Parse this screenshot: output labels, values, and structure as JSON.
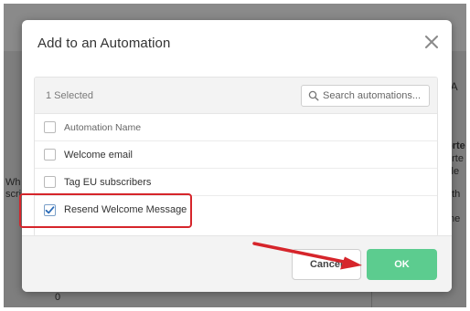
{
  "background": {
    "left_text_1": "Wh",
    "left_text_2": "scri",
    "right_text_1": "nt A",
    "right_text_2": "orte",
    "right_text_3": "orte",
    "right_text_4": "file",
    "right_text_5": "nth",
    "right_text_6": "me",
    "bottom_value": "0"
  },
  "modal": {
    "title": "Add to an Automation",
    "selected_count": "1 Selected",
    "search_placeholder": "Search automations...",
    "column_header": "Automation Name",
    "rows": [
      {
        "label": "Welcome email",
        "checked": false
      },
      {
        "label": "Tag EU subscribers",
        "checked": false
      },
      {
        "label": "Resend Welcome Message",
        "checked": true
      }
    ],
    "cancel_label": "Cancel",
    "ok_label": "OK"
  },
  "colors": {
    "ok_button": "#5ccc8f",
    "highlight": "#d6252b",
    "checkmark": "#2b6cb8"
  },
  "icons": {
    "close": "close-icon",
    "search": "search-icon",
    "check": "check-icon",
    "arrow": "annotation-arrow"
  }
}
